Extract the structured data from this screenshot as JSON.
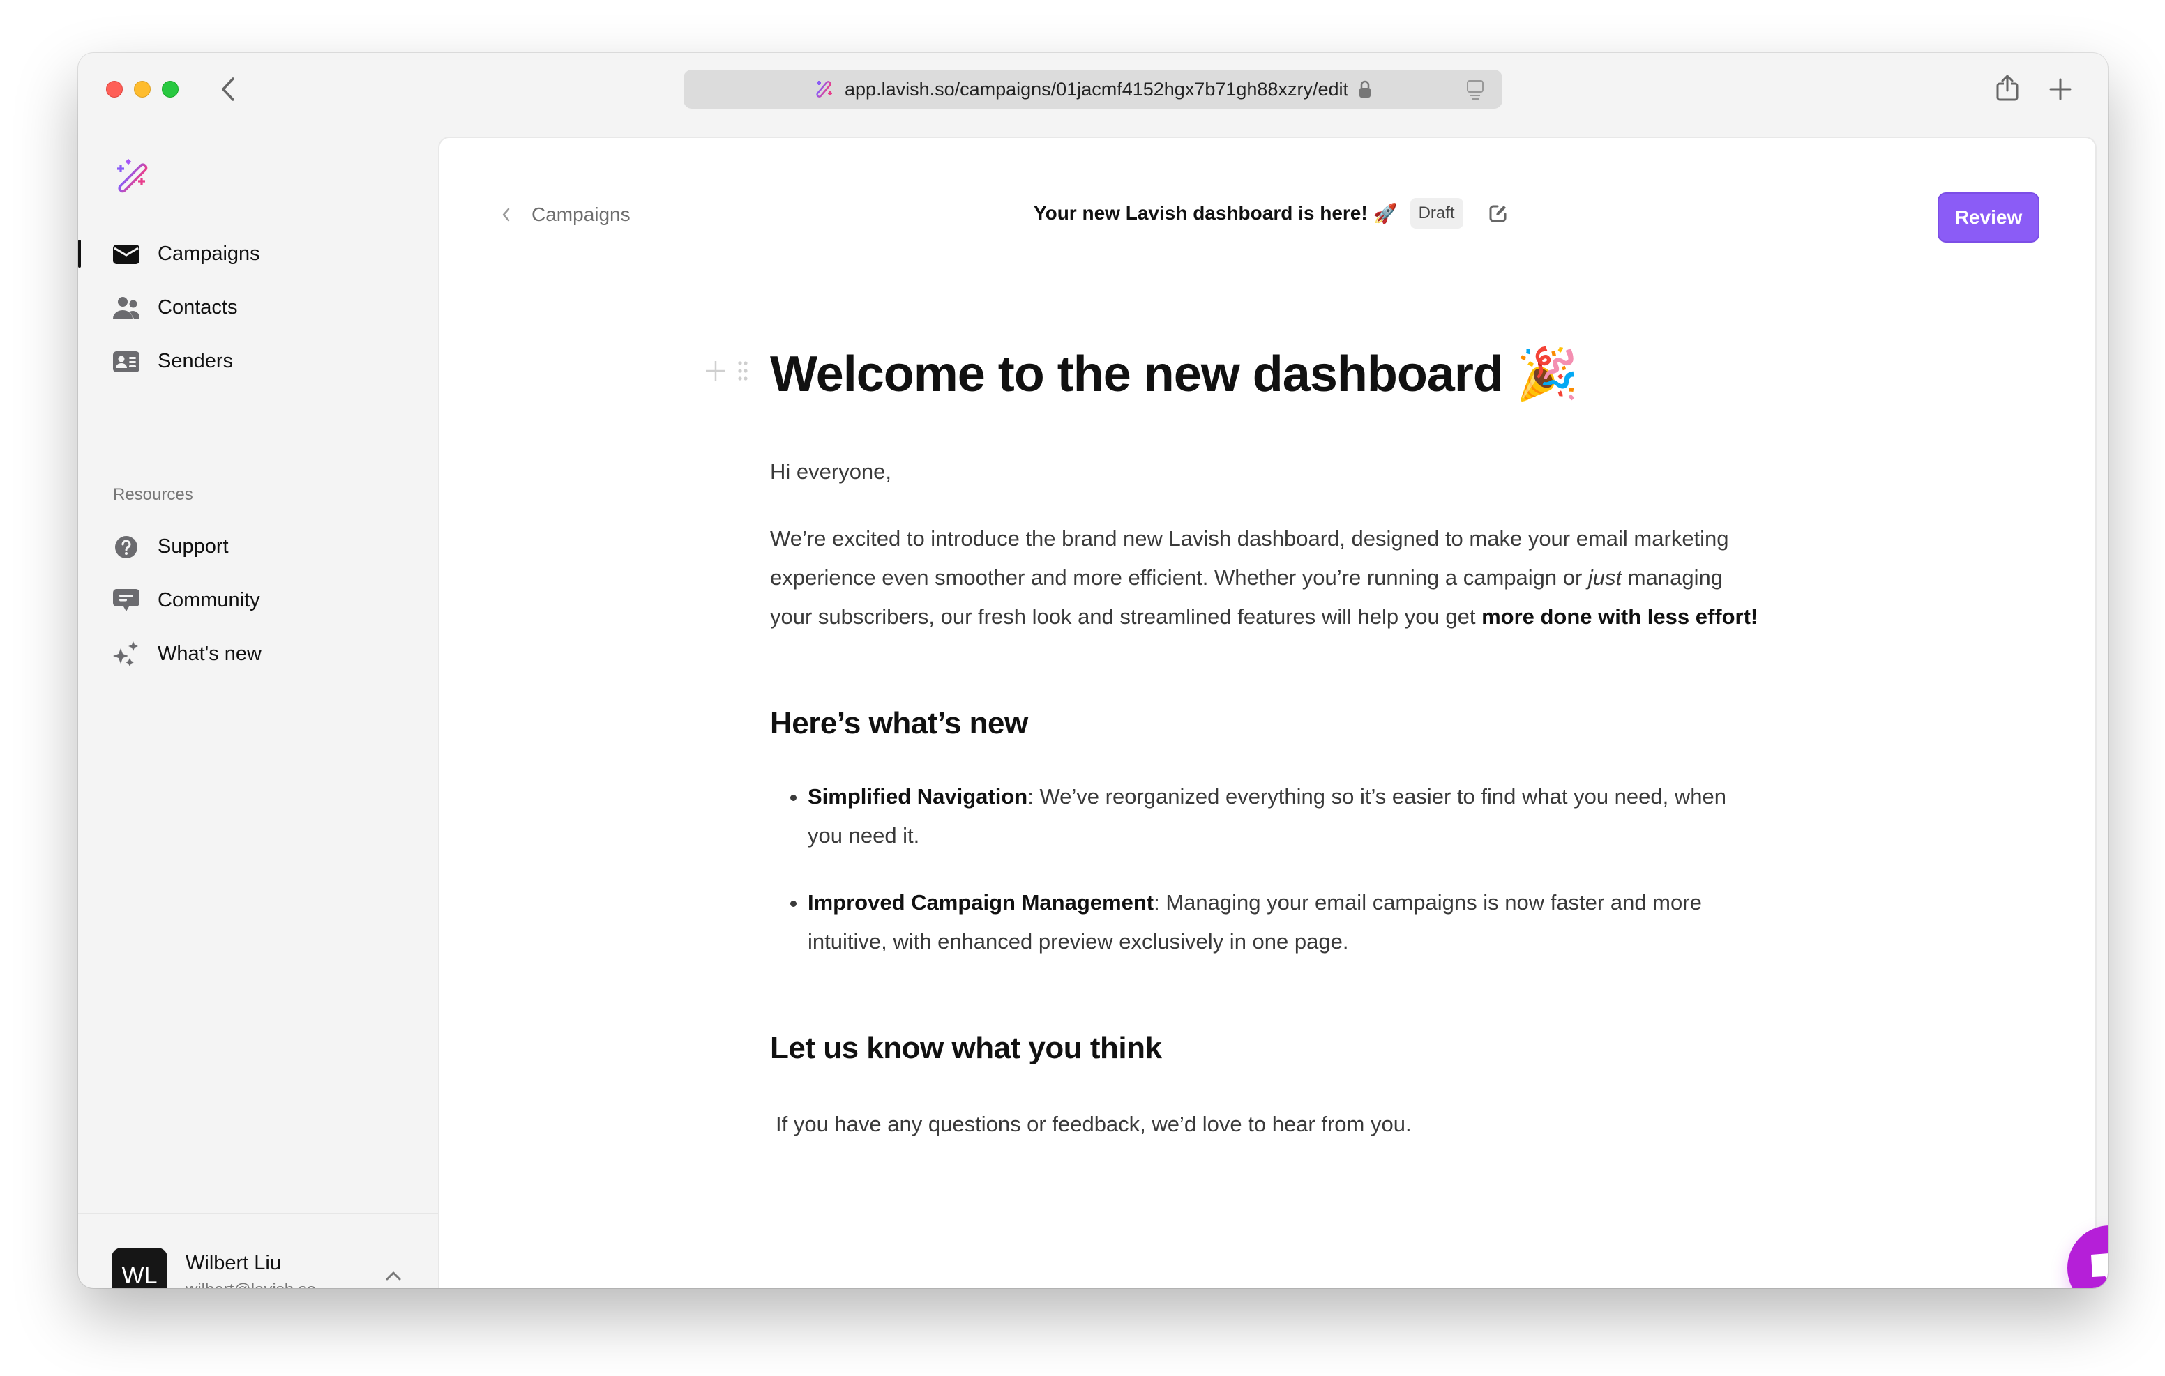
{
  "browser": {
    "url": "app.lavish.so/campaigns/01jacmf4152hgx7b71gh88xzry/edit",
    "icons": {
      "back": "chevron-left-icon",
      "site": "magic-wand-icon",
      "lock": "lock-icon",
      "reader": "reader-mode-icon",
      "share": "share-icon",
      "new_tab": "plus-icon"
    }
  },
  "sidebar": {
    "logo": "magic-wand-logo",
    "items": [
      {
        "label": "Campaigns",
        "icon": "envelope-icon",
        "active": true
      },
      {
        "label": "Contacts",
        "icon": "users-icon",
        "active": false
      },
      {
        "label": "Senders",
        "icon": "id-card-icon",
        "active": false
      }
    ],
    "resources_label": "Resources",
    "resources": [
      {
        "label": "Support",
        "icon": "question-circle-icon"
      },
      {
        "label": "Community",
        "icon": "chat-bubble-icon"
      },
      {
        "label": "What's new",
        "icon": "sparkles-icon"
      }
    ],
    "user": {
      "initials": "WL",
      "name": "Wilbert Liu",
      "email": "wilbert@lavish.so"
    }
  },
  "header": {
    "breadcrumb": "Campaigns",
    "title": "Your new Lavish dashboard is here!",
    "title_emoji": "🚀",
    "status": "Draft",
    "review_label": "Review",
    "accent": "#8b5cf6"
  },
  "document": {
    "heading": "Welcome to the new dashboard",
    "heading_emoji": "🎉",
    "greeting": "Hi everyone,",
    "intro_part1": "We’re excited to introduce the brand new Lavish dashboard, designed to make your email marketing experience even smoother and more efficient. Whether you’re running a campaign or ",
    "intro_italic": "just",
    "intro_part2": " managing your subscribers, our fresh look and streamlined features will help you get ",
    "intro_bold": "more done with less effort!",
    "section1_heading": "Here’s what’s new",
    "features": [
      {
        "title": "Simplified Navigation",
        "text": ": We’ve reorganized everything so it’s easier to find what you need, when you need it."
      },
      {
        "title": "Improved Campaign Management",
        "text": ": Managing your email campaigns is now faster and more intuitive, with enhanced preview exclusively in one page."
      }
    ],
    "section2_heading": "Let us know what you think",
    "closing": "If you have any questions or feedback, we’d love to hear from you."
  },
  "chat_widget": {
    "icon": "chat-icon",
    "color": "#b51fd8"
  }
}
